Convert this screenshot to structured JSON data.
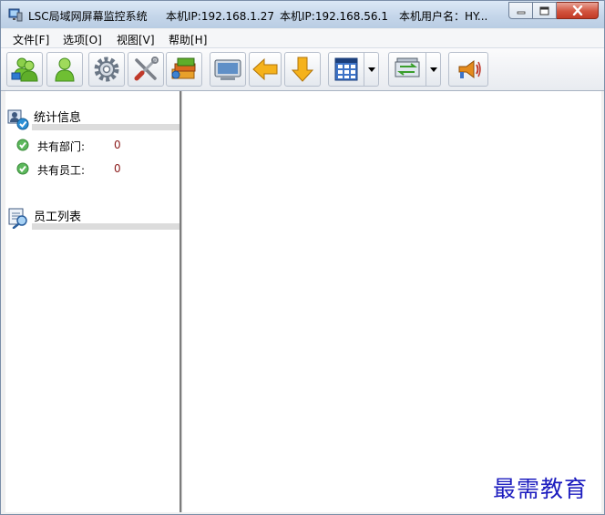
{
  "titlebar": {
    "app_name": "LSC局域网屏幕监控系统",
    "ip_label_1": "本机IP:192.168.1.27",
    "ip_label_2": "本机IP:192.168.56.1",
    "user_label": "本机用户名：HY..."
  },
  "menu": {
    "items": [
      {
        "label": "文件[F]"
      },
      {
        "label": "选项[O]"
      },
      {
        "label": "视图[V]"
      },
      {
        "label": "帮助[H]"
      }
    ]
  },
  "toolbar": {
    "icons": [
      "users-group-icon",
      "user-icon",
      "gear-icon",
      "tools-icon",
      "books-icon",
      "monitor-icon",
      "arrow-left-icon",
      "arrow-down-icon",
      "grid-view-icon",
      "switch-icon",
      "broadcast-icon"
    ]
  },
  "sidebar": {
    "stats_title": "统计信息",
    "departments_label": "共有部门:",
    "departments_count": "0",
    "employees_label": "共有员工:",
    "employees_count": "0",
    "employee_list_title": "员工列表"
  },
  "watermark": "最需教育",
  "colors": {
    "title_gradient_top": "#dbe8f6",
    "close_button": "#c23a25",
    "count_text": "#8b1a1a",
    "watermark": "#1d1dbf"
  }
}
